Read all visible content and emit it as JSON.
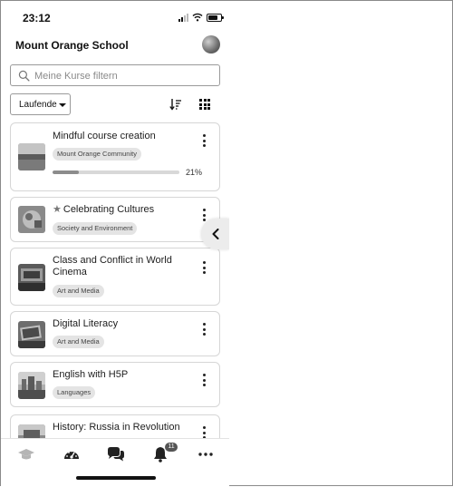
{
  "status_bar": {
    "time": "23:12"
  },
  "header": {
    "site_name": "Mount Orange School"
  },
  "search": {
    "placeholder": "Meine Kurse filtern",
    "value": ""
  },
  "filter": {
    "selected": "Laufende"
  },
  "courses": [
    {
      "title": "Mindful course creation",
      "category": "Mount Orange Community",
      "progress_percent": 21,
      "progress_label": "21%",
      "starred": false,
      "thumb_color": "#6d6d6d"
    },
    {
      "title": "Celebrating Cultures",
      "category": "Society and Environment",
      "starred": true,
      "thumb_color": "#8a8a8a"
    },
    {
      "title": "Class and Conflict in World Cinema",
      "category": "Art and Media",
      "starred": false,
      "thumb_color": "#5a5a5a"
    },
    {
      "title": "Digital Literacy",
      "category": "Art and Media",
      "starred": false,
      "thumb_color": "#4d4d4d"
    },
    {
      "title": "English with H5P",
      "category": "Languages",
      "starred": false,
      "thumb_color": "#7a7a7a"
    },
    {
      "title": "History: Russia in Revolution",
      "category": "",
      "starred": false,
      "thumb_color": "#6a6a6a"
    }
  ],
  "tab_bar": {
    "items": [
      {
        "name": "courses",
        "icon": "graduation-cap-icon"
      },
      {
        "name": "dashboard",
        "icon": "gauge-icon"
      },
      {
        "name": "messages",
        "icon": "chat-bubbles-icon"
      },
      {
        "name": "notifications",
        "icon": "bell-icon",
        "badge": "11"
      },
      {
        "name": "more",
        "icon": "ellipsis-icon"
      }
    ]
  },
  "colors": {
    "accent": "#555555",
    "border": "#d6d6d6",
    "tag_bg": "#e4e4e4"
  }
}
